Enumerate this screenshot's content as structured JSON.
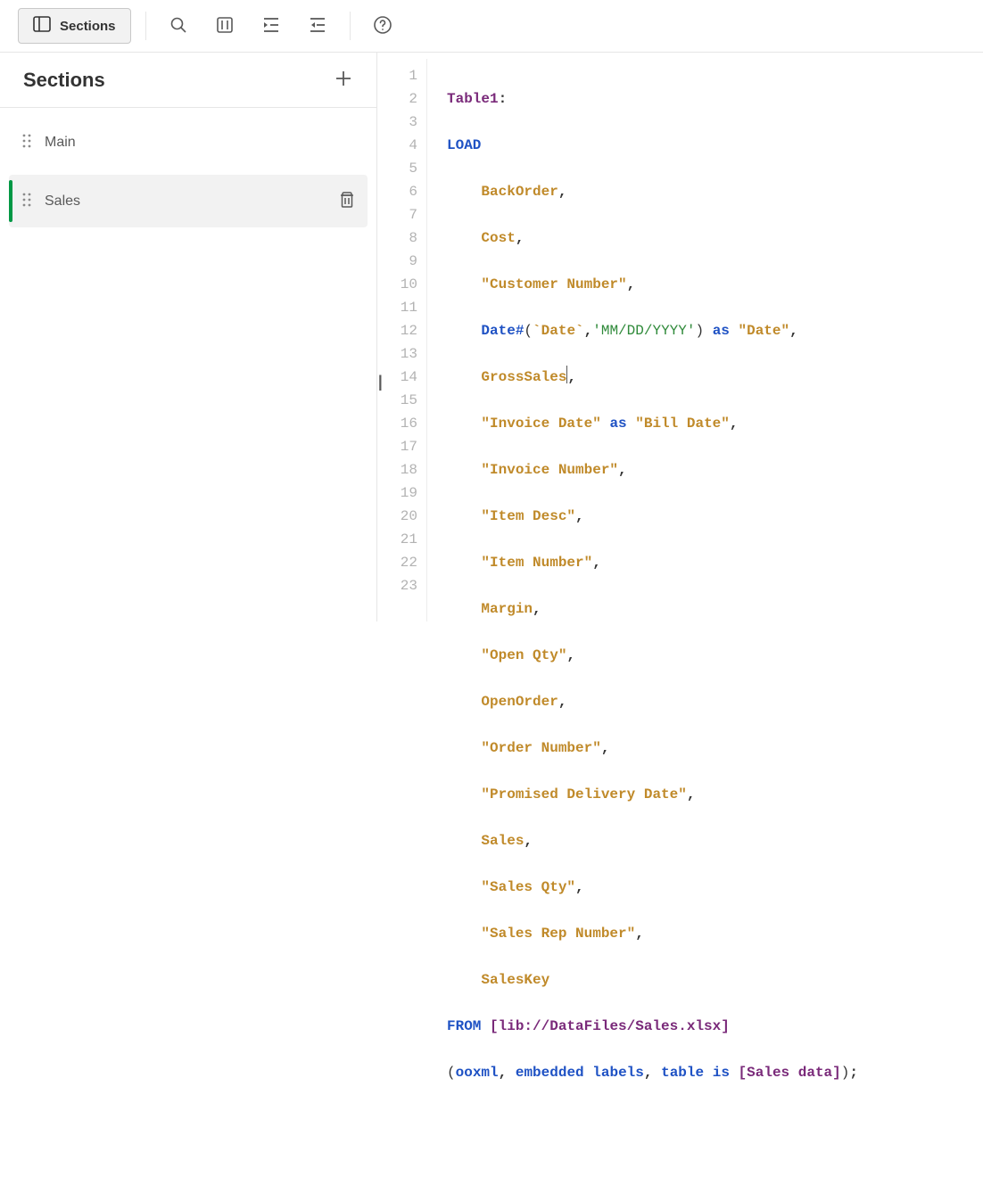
{
  "toolbar": {
    "sections_label": "Sections"
  },
  "sidebar": {
    "title": "Sections",
    "items": [
      {
        "label": "Main",
        "active": false
      },
      {
        "label": "Sales",
        "active": true
      }
    ]
  },
  "editor": {
    "line_count": 23,
    "tokens": {
      "table_def": "Table1",
      "load": "LOAD",
      "from": "FROM",
      "as": "as",
      "is": "is",
      "ooxml": "ooxml",
      "embedded_labels": "embedded labels",
      "table": "table",
      "date_fn": "Date#",
      "date_backtick": "`Date`",
      "date_fmt": "'MM/DD/YYYY'",
      "date_alias": "\"Date\"",
      "invoice_date_alias": "\"Bill Date\"",
      "lib_path": "[lib://DataFiles/Sales.xlsx]",
      "sheet": "[Sales data]",
      "fields": {
        "backorder": "BackOrder",
        "cost": "Cost",
        "customer_number": "\"Customer Number\"",
        "gross_sales": "GrossSales",
        "invoice_date": "\"Invoice Date\"",
        "invoice_number": "\"Invoice Number\"",
        "item_desc": "\"Item Desc\"",
        "item_number": "\"Item Number\"",
        "margin": "Margin",
        "open_qty": "\"Open Qty\"",
        "open_order": "OpenOrder",
        "order_number": "\"Order Number\"",
        "promised_delivery_date": "\"Promised Delivery Date\"",
        "sales": "Sales",
        "sales_qty": "\"Sales Qty\"",
        "sales_rep_number": "\"Sales Rep Number\"",
        "sales_key": "SalesKey"
      }
    }
  }
}
